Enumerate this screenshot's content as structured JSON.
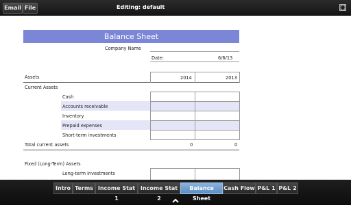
{
  "toolbar": {
    "email_label": "Email",
    "file_label": "File",
    "editing_title": "Editing: default"
  },
  "sheet": {
    "title": "Balance Sheet",
    "company_label": "Company Name",
    "date_label": "Date:",
    "date_value": "6/6/13",
    "assets_label": "Assets",
    "year1": "2014",
    "year2": "2013",
    "current_assets_label": "Current Assets",
    "rows": [
      {
        "label": "Cash"
      },
      {
        "label": "Accounts receivable"
      },
      {
        "label": "Inventory"
      },
      {
        "label": "Prepaid expenses"
      },
      {
        "label": "Short-term investments"
      }
    ],
    "total_label": "Total current assets",
    "total_2014": "0",
    "total_2013": "0",
    "fixed_label": "Fixed (Long-Term) Assets",
    "lt_investments_label": "Long-term investments"
  },
  "tabs": [
    {
      "label": "Intro"
    },
    {
      "label": "Terms"
    },
    {
      "label": "Income Stat 1"
    },
    {
      "label": "Income Stat 2"
    },
    {
      "label": "Balance Sheet"
    },
    {
      "label": "Cash Flow"
    },
    {
      "label": "P&L 1"
    },
    {
      "label": "P&L 2"
    }
  ],
  "active_tab": "Balance Sheet",
  "colors": {
    "title_band": "#7b86d6",
    "row_highlight": "#e4e6f8",
    "active_tab": "#6b9ccf"
  },
  "icons": {
    "expand": "expand-icon",
    "chevron": "chevron-up-icon"
  }
}
